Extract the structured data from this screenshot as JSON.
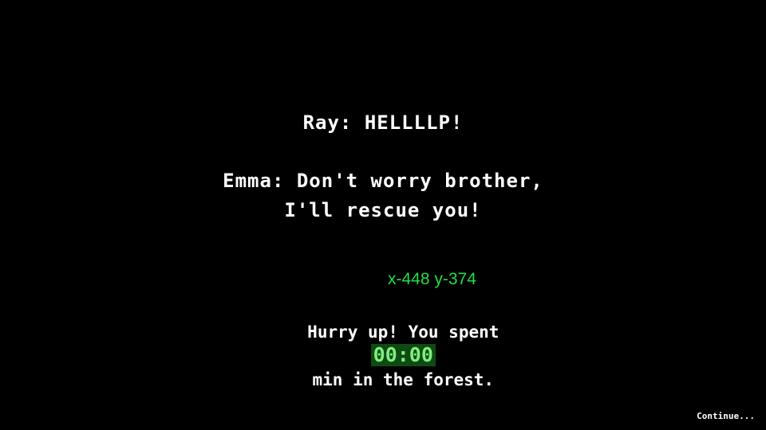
{
  "dialogue": {
    "line1": "Ray: HELLLLP!",
    "line2": "Emma: Don't worry brother,",
    "line3": "I'll rescue you!"
  },
  "debug": {
    "coords_text": "x-448 y-374"
  },
  "status": {
    "prefix": "Hurry up! You spent",
    "timer": "00:00",
    "suffix": "min in the forest."
  },
  "controls": {
    "continue_label": "Continue..."
  },
  "colors": {
    "background": "#000000",
    "text": "#ffffff",
    "timer_bg": "#0f4a12",
    "timer_text": "#7fee7f",
    "debug_text": "#22dd44"
  }
}
